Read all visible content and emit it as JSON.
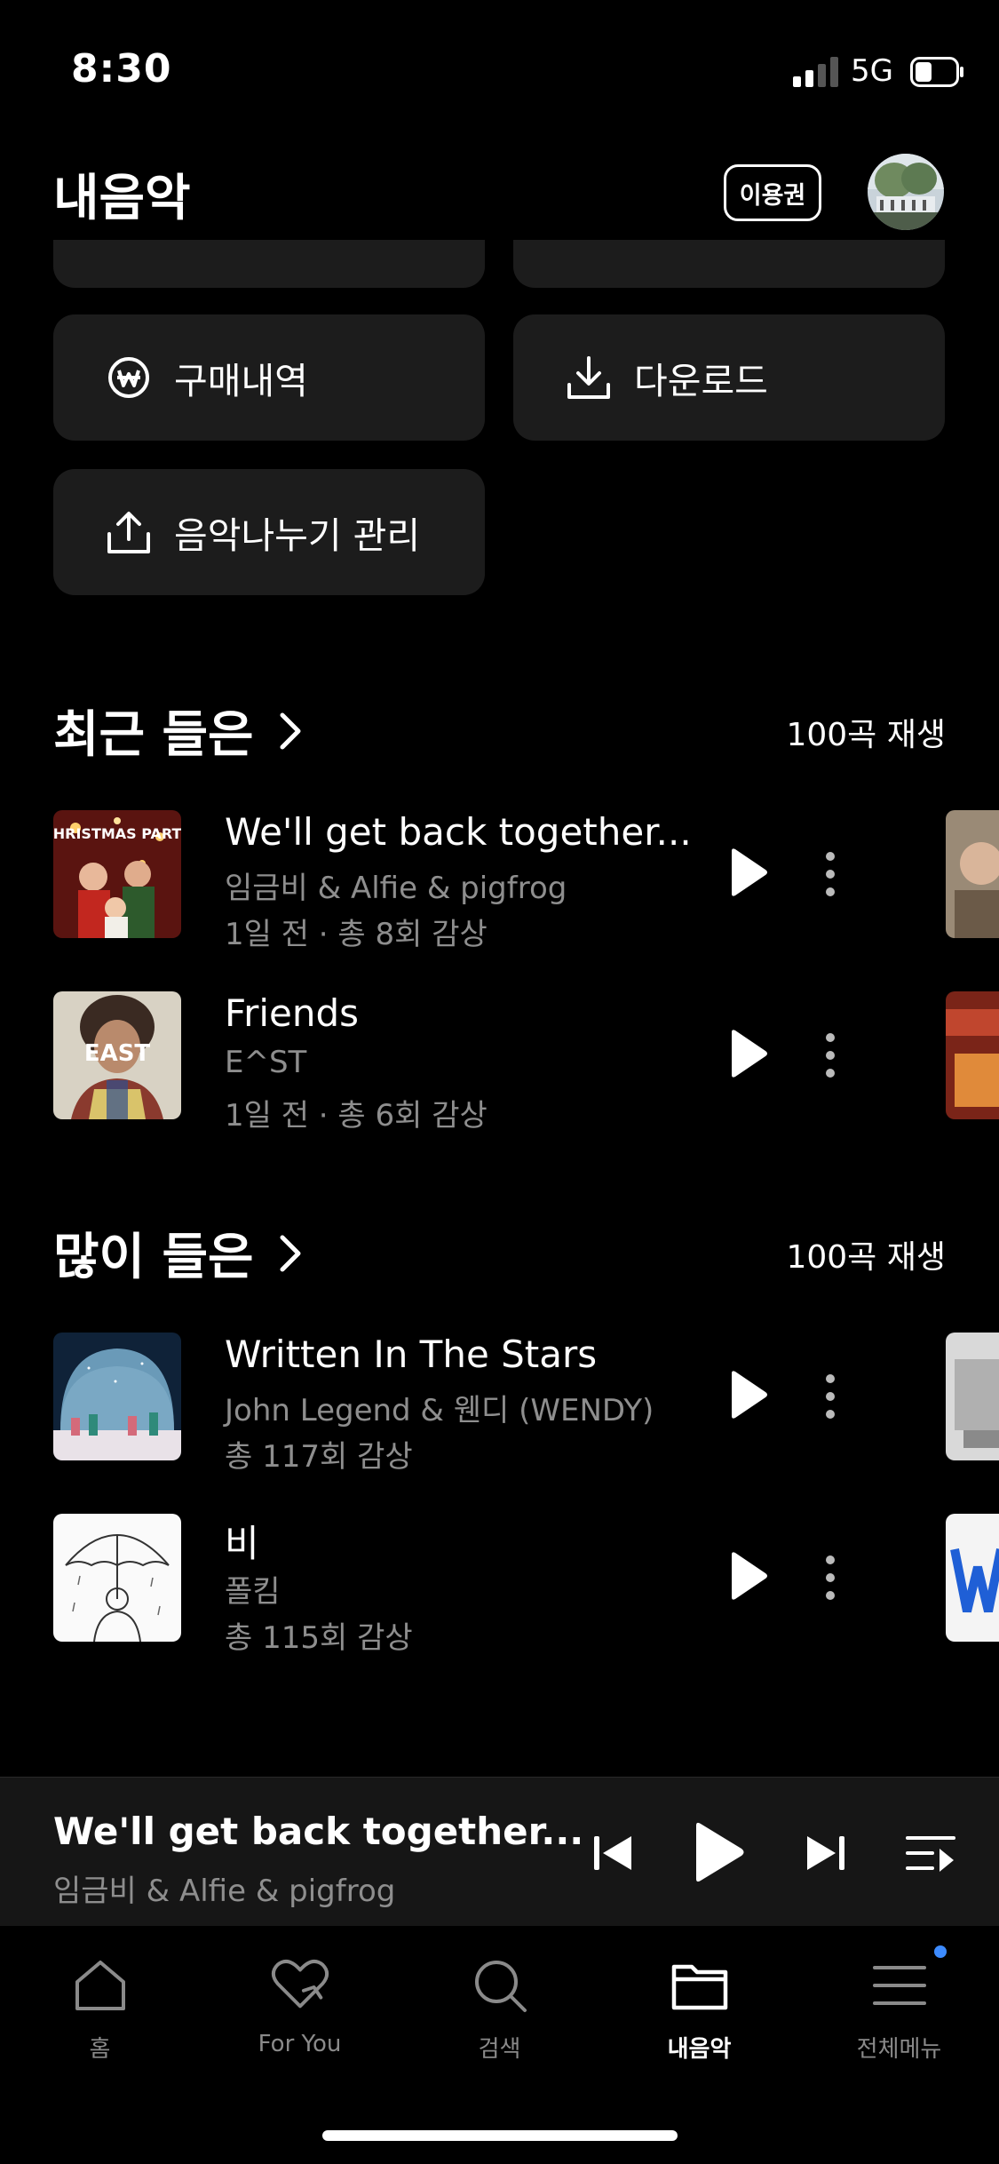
{
  "status_bar": {
    "time": "8:30",
    "network": "5G"
  },
  "header": {
    "title": "내음악",
    "pass_label": "이용권"
  },
  "tiles": {
    "purchase": "구매내역",
    "download": "다운로드",
    "share": "음악나누기 관리"
  },
  "recent": {
    "title": "최근 들은",
    "action": "100곡 재생",
    "items": [
      {
        "title": "We'll get back together...",
        "artist": "임금비 & Alfie & pigfrog",
        "meta": "1일 전 · 총 8회 감상"
      },
      {
        "title": "Friends",
        "artist": "E^ST",
        "meta": "1일 전 · 총 6회 감상"
      }
    ]
  },
  "most": {
    "title": "많이 들은",
    "action": "100곡 재생",
    "items": [
      {
        "title": "Written In The Stars",
        "artist": "John Legend & 웬디 (WENDY)",
        "meta": "총 117회 감상"
      },
      {
        "title": "비",
        "artist": "폴킴",
        "meta": "총 115회 감상"
      }
    ]
  },
  "album_art": {
    "christmas": "CHRISTMAS PARTY",
    "east": "EAST"
  },
  "mini_player": {
    "title": "We'll get back together...",
    "artist": "임금비 & Alfie & pigfrog"
  },
  "tabs": [
    {
      "label": "홈",
      "icon": "home-icon"
    },
    {
      "label": "For You",
      "icon": "heart-icon"
    },
    {
      "label": "검색",
      "icon": "search-icon"
    },
    {
      "label": "내음악",
      "icon": "folder-icon",
      "active": true
    },
    {
      "label": "전체메뉴",
      "icon": "menu-icon"
    }
  ],
  "colors": {
    "background": "#000000",
    "tile": "#1c1c1c",
    "subtext": "#8e8e8e",
    "badge": "#3d8bff"
  }
}
